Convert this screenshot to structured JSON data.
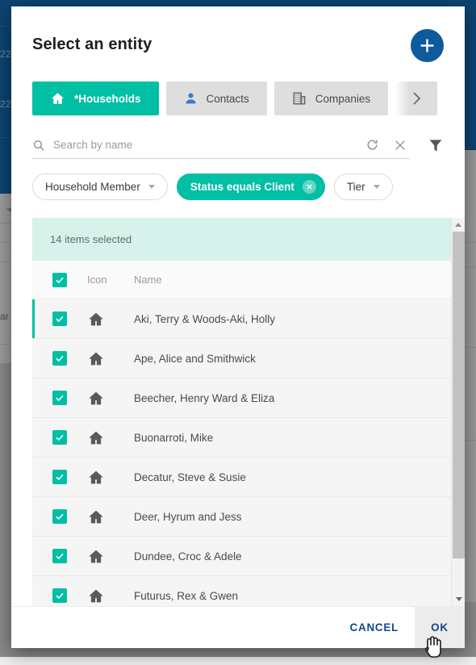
{
  "modal": {
    "title": "Select an entity",
    "add_button": {
      "icon": "plus-icon",
      "label": "+"
    },
    "tabs": [
      {
        "label": "*Households",
        "icon": "home-icon",
        "active": true
      },
      {
        "label": "Contacts",
        "icon": "person-icon",
        "active": false
      },
      {
        "label": "Companies",
        "icon": "building-icon",
        "active": false
      }
    ],
    "tabs_next": {
      "icon": "chevron-right-icon"
    },
    "search": {
      "placeholder": "Search by name",
      "value": "",
      "search_icon": "search-icon",
      "refresh_icon": "refresh-icon",
      "clear_icon": "close-icon",
      "filter_icon": "funnel-icon"
    },
    "chips": [
      {
        "label": "Household Member",
        "type": "dropdown",
        "icon": "chevron-down-icon",
        "active": false
      },
      {
        "label": "Status equals Client",
        "type": "applied",
        "icon": "remove-icon",
        "active": true
      },
      {
        "label": "Tier",
        "type": "dropdown",
        "icon": "chevron-down-icon",
        "active": false
      }
    ],
    "selection_banner": "14 items selected",
    "table": {
      "columns": [
        "",
        "Icon",
        "Name"
      ],
      "select_all_checked": true,
      "rows": [
        {
          "checked": true,
          "icon": "home-icon",
          "name": "Aki, Terry & Woods-Aki, Holly"
        },
        {
          "checked": true,
          "icon": "home-icon",
          "name": "Ape, Alice and Smithwick"
        },
        {
          "checked": true,
          "icon": "home-icon",
          "name": "Beecher, Henry Ward & Eliza"
        },
        {
          "checked": true,
          "icon": "home-icon",
          "name": "Buonarroti, Mike"
        },
        {
          "checked": true,
          "icon": "home-icon",
          "name": "Decatur, Steve & Susie"
        },
        {
          "checked": true,
          "icon": "home-icon",
          "name": "Deer, Hyrum and Jess"
        },
        {
          "checked": true,
          "icon": "home-icon",
          "name": "Dundee, Croc & Adele"
        },
        {
          "checked": true,
          "icon": "home-icon",
          "name": "Futurus, Rex & Gwen"
        }
      ]
    },
    "footer": {
      "cancel_label": "CANCEL",
      "ok_label": "OK"
    }
  },
  "background": {
    "years": [
      "22",
      "22"
    ],
    "fragment_label": "ar"
  },
  "colors": {
    "accent_teal": "#00bfa5",
    "accent_blue": "#0d5a9e",
    "link_blue": "#134a8e",
    "banner_mint": "#d6f2ea",
    "row_gray": "#f5f5f5",
    "tab_gray": "#dedede",
    "navy": "#0d4472"
  }
}
